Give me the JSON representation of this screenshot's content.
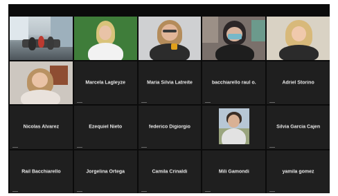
{
  "participants_row1": [
    {
      "id": "office-room"
    },
    {
      "id": "green-wall-woman"
    },
    {
      "id": "glasses-woman"
    },
    {
      "id": "masked-man"
    },
    {
      "id": "blonde-woman"
    }
  ],
  "tiles": [
    {
      "label": "Marcela Lagleyze"
    },
    {
      "label": "Maria Silvia Latreite"
    },
    {
      "label": "bacchiarello raul o."
    },
    {
      "label": "Adriel Storino"
    },
    {
      "label": "Nicolas Alvarez"
    },
    {
      "label": "Ezequiel Nieto"
    },
    {
      "label": "federico Digiorgio"
    },
    {
      "label": "Silvia Garcia Cajen"
    },
    {
      "label": "Rail Bacchiarello"
    },
    {
      "label": "Jorgelina Ortega"
    },
    {
      "label": "Camila Crinaldi"
    },
    {
      "label": "Mili Gamondi"
    },
    {
      "label": "yamila gomez"
    }
  ],
  "colors": {
    "background": "#0b0b0b",
    "tile": "#1f1f1f",
    "text": "#e9e9e9"
  }
}
